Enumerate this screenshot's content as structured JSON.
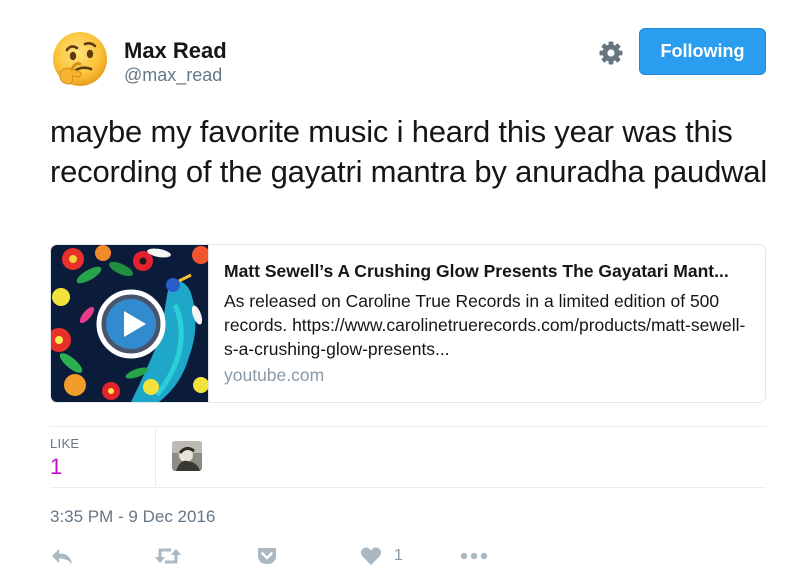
{
  "user": {
    "display_name": "Max Read",
    "handle": "@max_read",
    "avatar_icon": "thinking-face-emoji"
  },
  "follow_button": {
    "label": "Following",
    "color": "#2b9df0"
  },
  "settings_icon": "gear-icon",
  "tweet": {
    "text": "maybe my favorite music i heard this year was this recording of the gayatri mantra by anuradha paudwal"
  },
  "card": {
    "title": "Matt Sewell’s A Crushing Glow Presents The Gayatari Mant...",
    "description": "As released on Caroline True Records in a limited edition of 500 records. https://www.carolinetruerecords.com/products/matt-sewell-s-a-crushing-glow-presents...",
    "domain": "youtube.com",
    "thumb_icon": "play-button-icon"
  },
  "stats": {
    "likes_label": "LIKE",
    "likes_value": "1",
    "likes_color": "#c10ec6"
  },
  "timestamp": "3:35 PM - 9 Dec 2016",
  "actions": {
    "reply_icon": "reply-icon",
    "retweet_icon": "retweet-icon",
    "save_icon": "pocket-icon",
    "like_icon": "heart-icon",
    "like_count": "1",
    "more_icon": "more-icon"
  }
}
